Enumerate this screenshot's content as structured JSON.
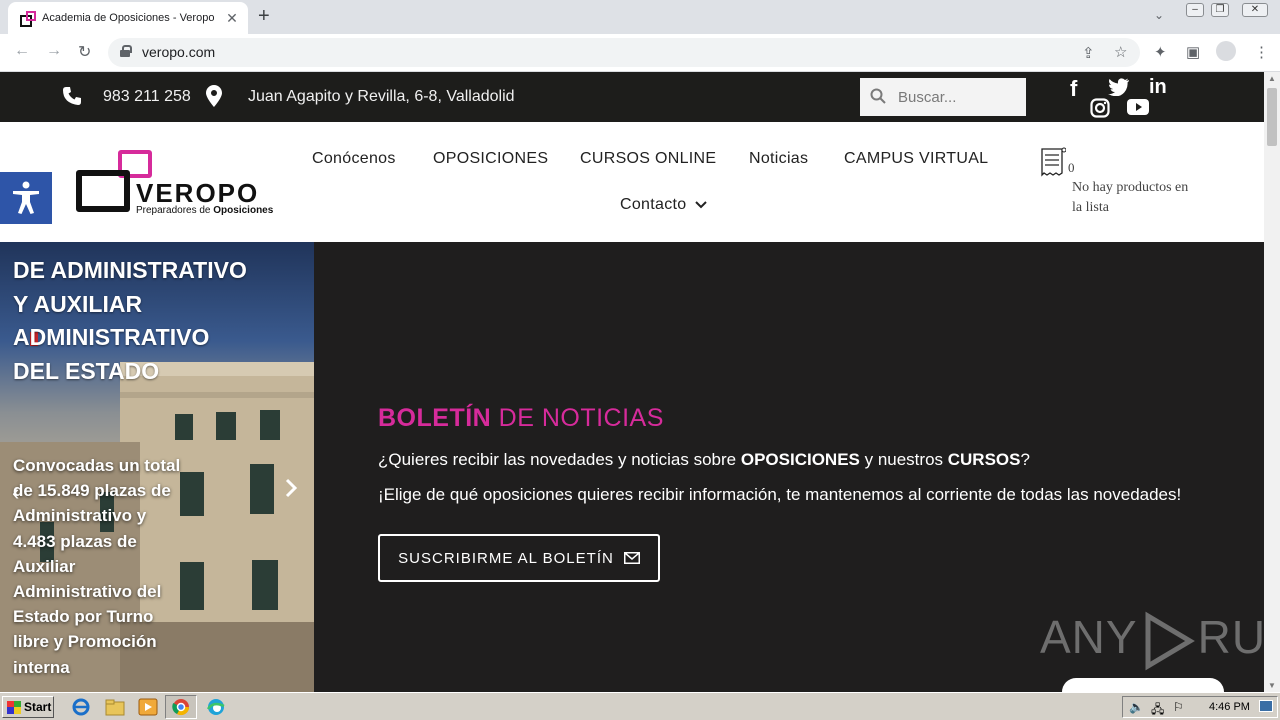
{
  "browser": {
    "tab_title": "Academia de Oposiciones - Veropo",
    "tab_close": "✕",
    "new_tab": "+",
    "url": "veropo.com"
  },
  "topbar": {
    "phone": "983 211 258",
    "address": "Juan Agapito y Revilla, 6-8, Valladolid",
    "search_placeholder": "Buscar...",
    "social": [
      "facebook",
      "twitter",
      "linkedin",
      "instagram",
      "youtube"
    ]
  },
  "header": {
    "logo_brand": "VEROPO",
    "logo_tag_plain": "Preparadores de ",
    "logo_tag_bold": "Oposiciones",
    "nav": [
      "Conócenos",
      "OPOSICIONES",
      "CURSOS ONLINE",
      "Noticias",
      "CAMPUS VIRTUAL",
      "Contacto"
    ],
    "cart_count": "0",
    "cart_empty": "No hay productos en la lista"
  },
  "hero": {
    "title": "DE ADMINISTRATIVO Y AUXILIAR ADMINISTRATIVO DEL ESTADO",
    "description": "Convocadas un total de 15.849 plazas de Administrativo y 4.483 plazas de Auxiliar Administrativo del Estado por Turno libre y Promoción interna"
  },
  "newsletter": {
    "title_bold": "BOLETÍN",
    "title_rest": " DE NOTICIAS",
    "line1_a": "¿Quieres recibir las novedades y noticias sobre ",
    "line1_b": "OPOSICIONES",
    "line1_c": " y nuestros ",
    "line1_d": "CURSOS",
    "line1_e": "?",
    "line2": "¡Elige de qué oposiciones quieres recibir información, te mantenemos al corriente de todas las novedades!",
    "button": "SUSCRIBIRME AL BOLETÍN"
  },
  "watermark": {
    "left": "ANY",
    "right": "RUN"
  },
  "taskbar": {
    "start": "Start",
    "clock": "4:46 PM"
  },
  "colors": {
    "brand_pink": "#d62b9b",
    "topbar_bg": "#1d1d1b",
    "accessibility_blue": "#2e55a8"
  }
}
